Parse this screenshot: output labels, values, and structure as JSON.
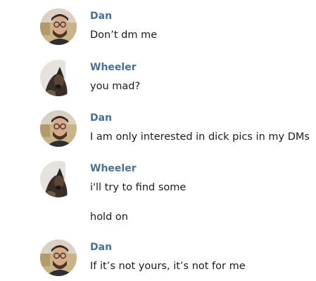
{
  "messages": [
    {
      "sender": "Dan",
      "avatar_icon": "dan-avatar-icon",
      "lines": [
        "Don’t dm me"
      ]
    },
    {
      "sender": "Wheeler",
      "avatar_icon": "wheeler-avatar-icon",
      "lines": [
        "you mad?"
      ]
    },
    {
      "sender": "Dan",
      "avatar_icon": "dan-avatar-icon",
      "lines": [
        "I am only interested in dick pics in my DMs"
      ]
    },
    {
      "sender": "Wheeler",
      "avatar_icon": "wheeler-avatar-icon",
      "lines": [
        "i'll try to find some",
        "hold on"
      ]
    },
    {
      "sender": "Dan",
      "avatar_icon": "dan-avatar-icon",
      "lines": [
        "If it’s not yours, it’s not for me"
      ]
    }
  ],
  "colors": {
    "sender_name": "#4a7092",
    "message_text": "#1a1a1a",
    "background": "#ffffff"
  }
}
